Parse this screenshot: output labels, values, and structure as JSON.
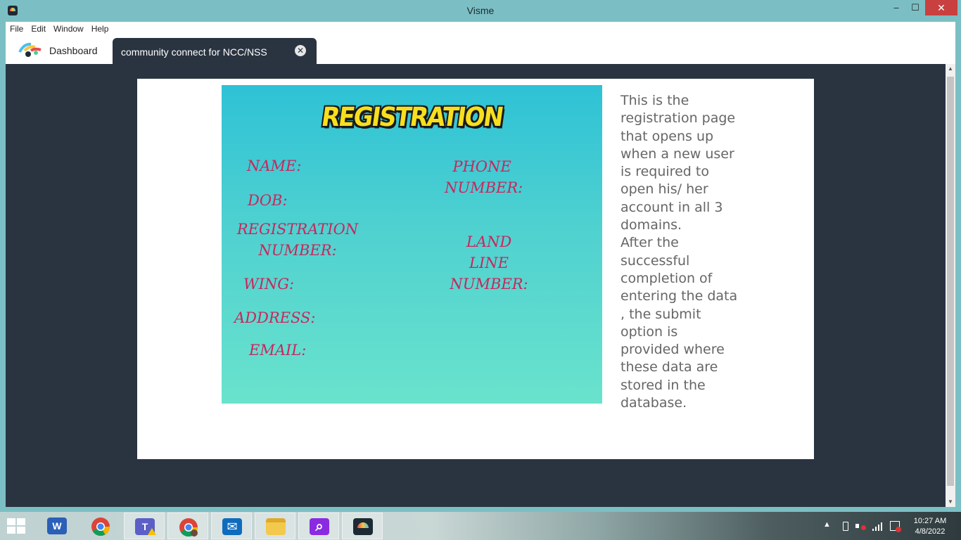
{
  "window": {
    "title": "Visme",
    "minimize_glyph": "–",
    "maximize_glyph": "☐",
    "close_glyph": "✕"
  },
  "menu": {
    "items": [
      "File",
      "Edit",
      "Window",
      "Help"
    ]
  },
  "tabs": {
    "dashboard_label": "Dashboard",
    "active_label": "community connect for NCC/NSS",
    "close_glyph": "✕"
  },
  "slide": {
    "card_title": "REGISTRATION",
    "fields": {
      "name": "NAME:",
      "dob": "DOB:",
      "registration_line1": "REGISTRATION",
      "registration_line2": "NUMBER:",
      "wing": "WING:",
      "address": "ADDRESS:",
      "email": "EMAIL:",
      "phone_line1": "PHONE",
      "phone_line2": "NUMBER:",
      "landline_line1": "LAND LINE",
      "landline_line2": "NUMBER:"
    },
    "description": [
      "This is the",
      "registration page",
      "that opens up",
      "when a new user",
      "is required to",
      "open his/ her",
      "account in all 3",
      "domains.",
      "After the",
      "successful",
      "completion of",
      "entering the data",
      ", the submit",
      "option is",
      "provided where",
      "these data are",
      "stored in the",
      "database."
    ]
  },
  "taskbar": {
    "apps": [
      {
        "name": "word-icon",
        "glyph": "W",
        "color": "#2b5fb8"
      },
      {
        "name": "chrome-icon",
        "glyph": "",
        "color": ""
      },
      {
        "name": "teams-icon",
        "glyph": "T",
        "color": "#5b5fc7"
      },
      {
        "name": "chrome-profile-icon",
        "glyph": "",
        "color": ""
      },
      {
        "name": "mail-icon",
        "glyph": "✉",
        "color": "#0f6cbd"
      },
      {
        "name": "file-explorer-icon",
        "glyph": "",
        "color": "#f2c94c"
      },
      {
        "name": "search-app-icon",
        "glyph": "⌕",
        "color": "#8a2be2"
      },
      {
        "name": "visme-icon",
        "glyph": "",
        "color": "#1e2a33"
      }
    ],
    "tray_arrow": "▲",
    "time": "10:27 AM",
    "date": "4/8/2022"
  }
}
